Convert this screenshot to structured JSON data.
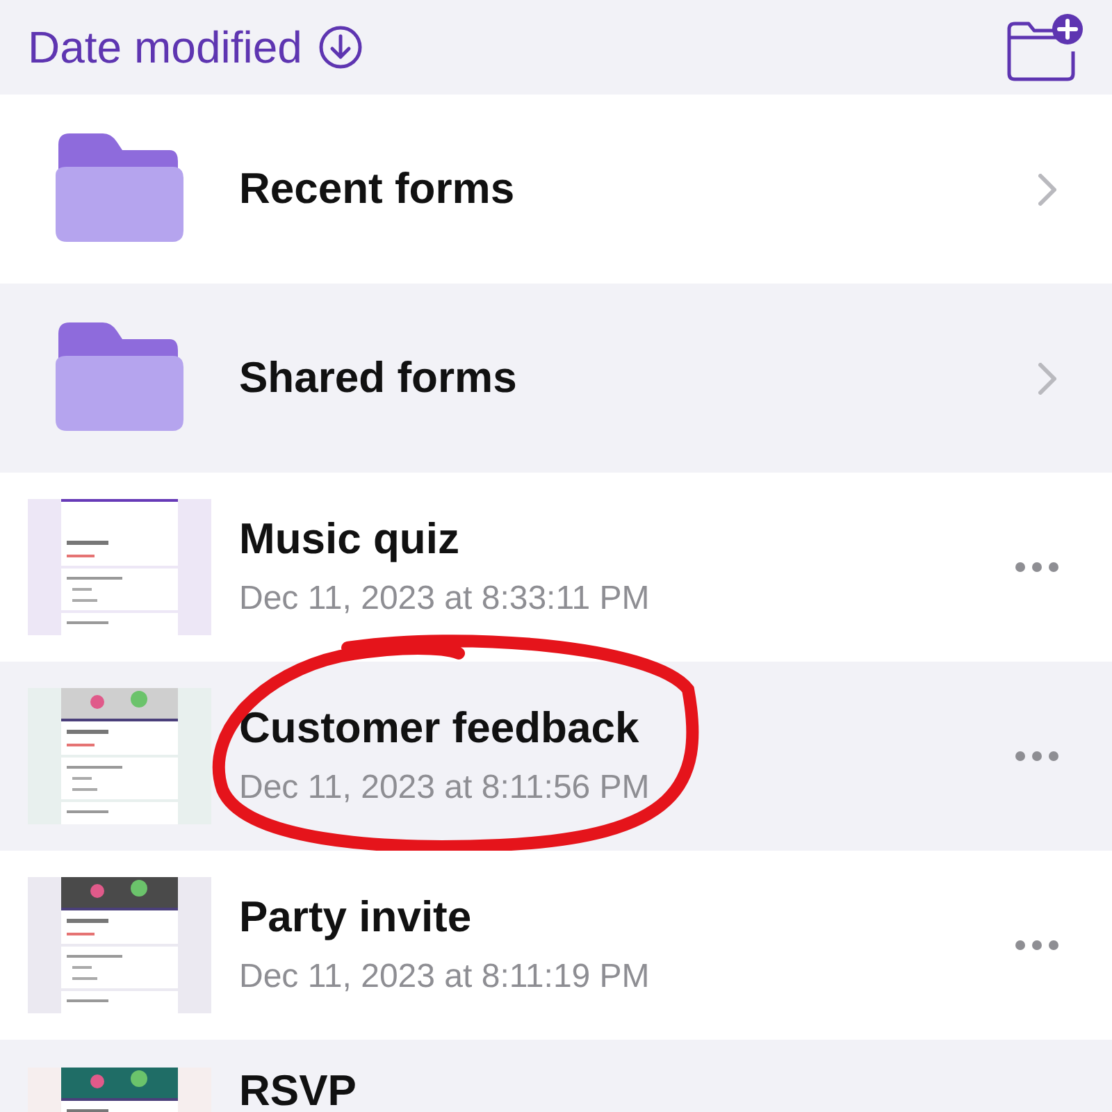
{
  "header": {
    "sort_label": "Date modified"
  },
  "folders": [
    {
      "name": "Recent forms"
    },
    {
      "name": "Shared forms"
    }
  ],
  "forms": [
    {
      "title": "Music quiz",
      "date": "Dec 11, 2023 at 8:33:11 PM",
      "banner": false,
      "annotated": false
    },
    {
      "title": "Customer feedback",
      "date": "Dec 11, 2023 at 8:11:56 PM",
      "banner": true,
      "annotated": true
    },
    {
      "title": "Party invite",
      "date": "Dec 11, 2023 at 8:11:19 PM",
      "banner": true,
      "annotated": false
    },
    {
      "title": "RSVP",
      "banner": true,
      "annotated": false
    }
  ]
}
